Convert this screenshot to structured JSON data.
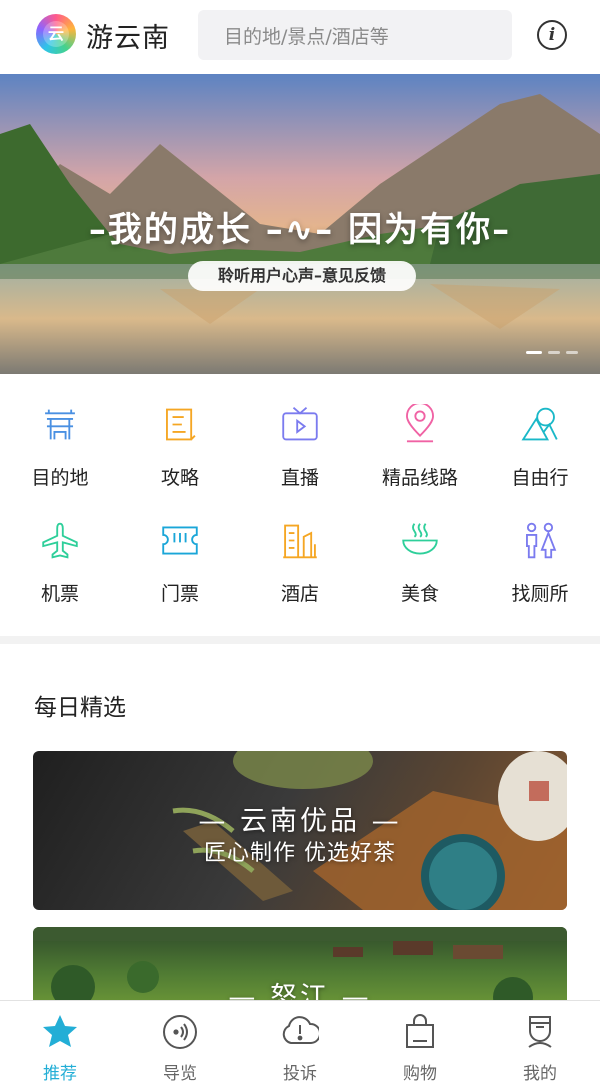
{
  "app": {
    "brand": "游云南",
    "logo_glyph": "云"
  },
  "search": {
    "placeholder": "目的地/景点/酒店等"
  },
  "banner": {
    "title": "–我的成长 –∿– 因为有你–",
    "subtitle": "聆听用户心声–意见反馈",
    "slides": 3,
    "active_slide": 1
  },
  "categories": [
    {
      "label": "目的地",
      "icon": "gate-icon",
      "color": "#4a90e2"
    },
    {
      "label": "攻略",
      "icon": "guide-book-icon",
      "color": "#f5a623"
    },
    {
      "label": "直播",
      "icon": "live-tv-icon",
      "color": "#7b7bef"
    },
    {
      "label": "精品线路",
      "icon": "location-pin-icon",
      "color": "#f062a4"
    },
    {
      "label": "自由行",
      "icon": "mountain-sun-icon",
      "color": "#1ab8c8"
    },
    {
      "label": "机票",
      "icon": "airplane-icon",
      "color": "#2ecf9a"
    },
    {
      "label": "门票",
      "icon": "ticket-icon",
      "color": "#1aa6d8"
    },
    {
      "label": "酒店",
      "icon": "hotel-icon",
      "color": "#f5a623"
    },
    {
      "label": "美食",
      "icon": "food-bowl-icon",
      "color": "#2ecf9a"
    },
    {
      "label": "找厕所",
      "icon": "restroom-icon",
      "color": "#7b7bef"
    }
  ],
  "daily": {
    "title": "每日精选",
    "cards": [
      {
        "title": "— 云南优品 —",
        "subtitle": "匠心制作 优选好茶"
      },
      {
        "title": "— 怒江 —"
      }
    ]
  },
  "tabbar": {
    "active_color": "#23aed6",
    "items": [
      {
        "label": "推荐",
        "icon": "star-icon",
        "active": true
      },
      {
        "label": "导览",
        "icon": "audio-guide-icon",
        "active": false
      },
      {
        "label": "投诉",
        "icon": "complaint-icon",
        "active": false
      },
      {
        "label": "购物",
        "icon": "shopping-bag-icon",
        "active": false
      },
      {
        "label": "我的",
        "icon": "profile-icon",
        "active": false
      }
    ]
  }
}
